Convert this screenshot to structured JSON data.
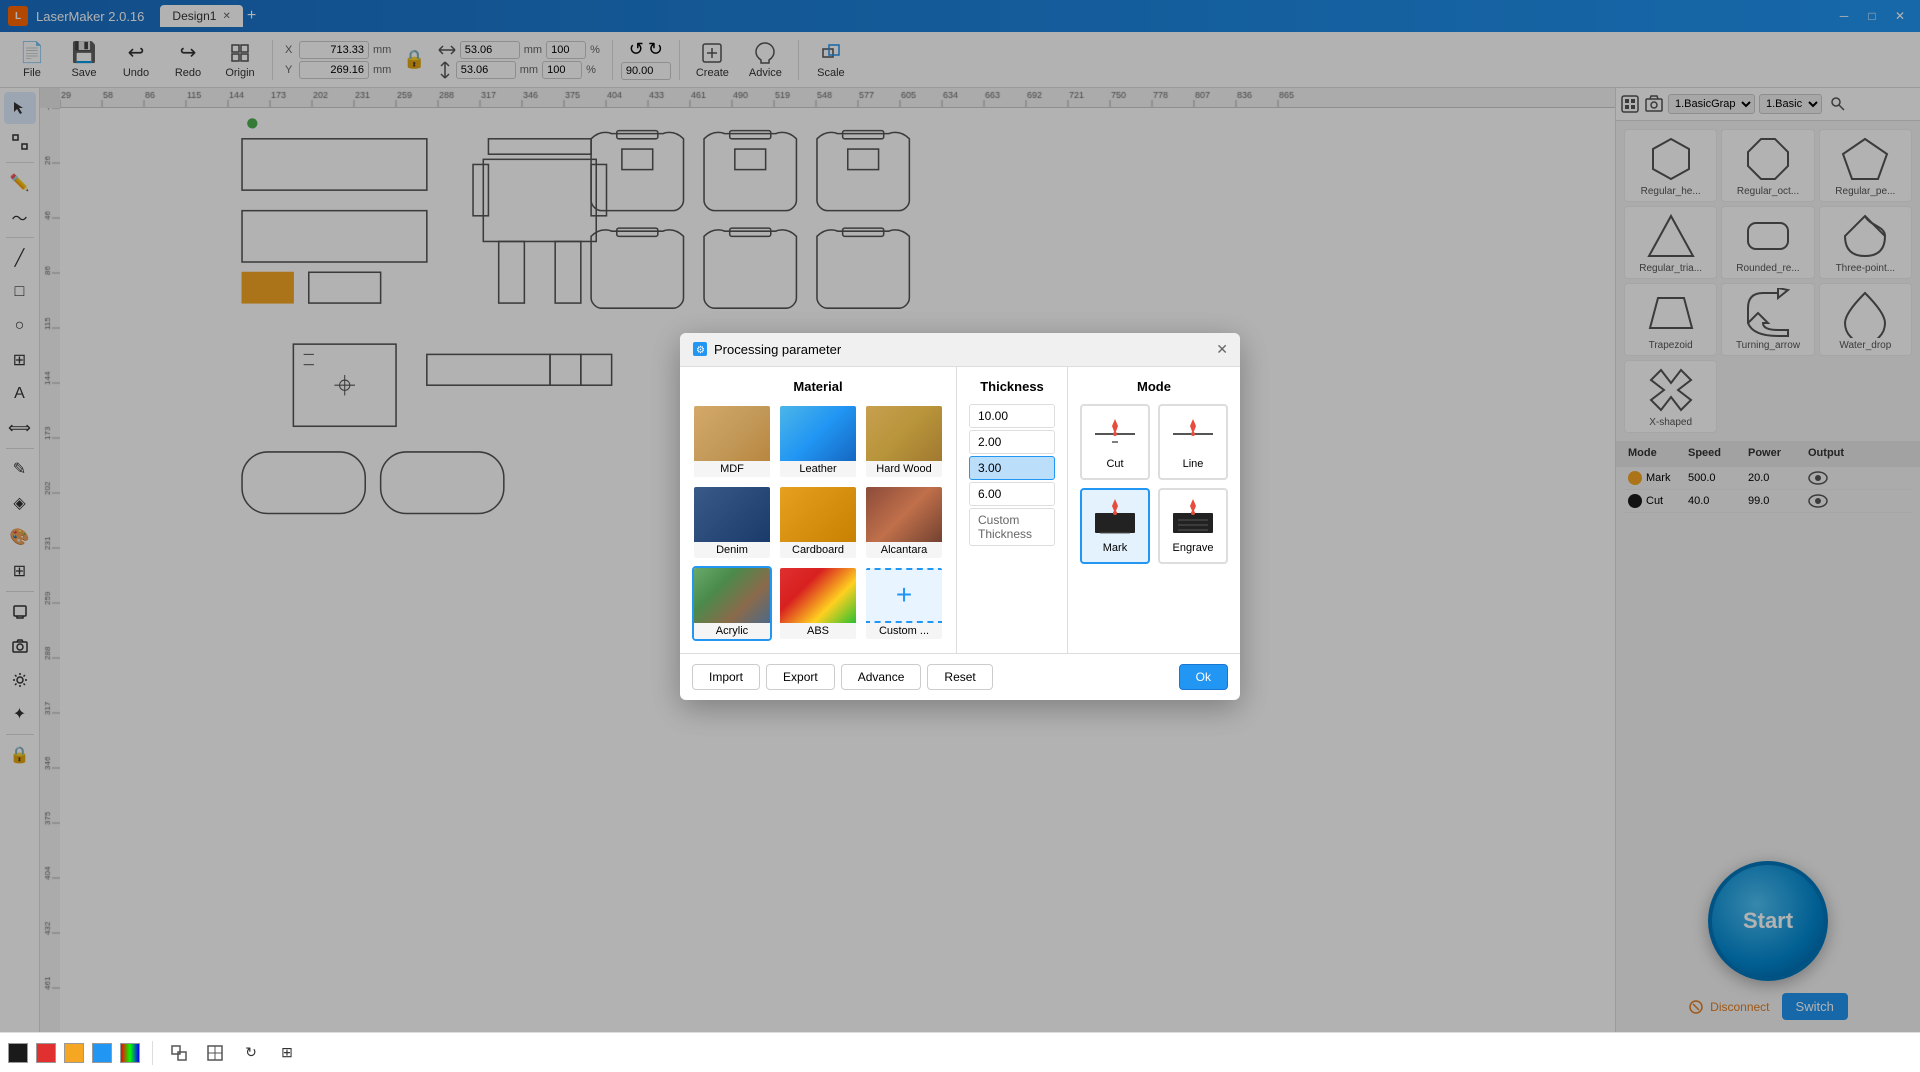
{
  "app": {
    "name": "LaserMaker 2.0.16",
    "tab": "Design1"
  },
  "toolbar": {
    "file_label": "File",
    "save_label": "Save",
    "undo_label": "Undo",
    "redo_label": "Redo",
    "origin_label": "Origin",
    "scale_label": "Scale",
    "create_label": "Create",
    "advice_label": "Advice",
    "x_label": "X",
    "y_label": "Y",
    "x_value": "713.33",
    "y_value": "269.16",
    "unit": "mm",
    "w_value": "53.06",
    "h_value": "53.06",
    "w_pct": "100",
    "h_pct": "100",
    "angle_value": "90.00"
  },
  "shapes_panel": {
    "dropdown1": "1.BasicGrap",
    "dropdown2": "1.Basic",
    "items": [
      {
        "id": "regular_hex",
        "label": "Regular_he..."
      },
      {
        "id": "regular_oct",
        "label": "Regular_oct..."
      },
      {
        "id": "regular_pe",
        "label": "Regular_pe..."
      },
      {
        "id": "regular_tri",
        "label": "Regular_tria..."
      },
      {
        "id": "rounded_re",
        "label": "Rounded_re..."
      },
      {
        "id": "three_point",
        "label": "Three-point..."
      },
      {
        "id": "trapezoid",
        "label": "Trapezoid"
      },
      {
        "id": "turning_arrow",
        "label": "Turning_arrow"
      },
      {
        "id": "water_drop",
        "label": "Water_drop"
      },
      {
        "id": "x_shaped",
        "label": "X-shaped"
      }
    ]
  },
  "mode_table": {
    "headers": [
      "Mode",
      "Speed",
      "Power",
      "Output"
    ],
    "rows": [
      {
        "color": "#f5a623",
        "color_name": "yellow",
        "label": "Mark",
        "speed": "500.0",
        "power": "20.0"
      },
      {
        "color": "#1a1a1a",
        "color_name": "black",
        "label": "Cut",
        "speed": "40.0",
        "power": "99.0"
      }
    ]
  },
  "dialog": {
    "title": "Processing parameter",
    "sections": {
      "material": {
        "title": "Material",
        "items": [
          {
            "id": "mdf",
            "label": "MDF"
          },
          {
            "id": "leather",
            "label": "Leather"
          },
          {
            "id": "hard_wood",
            "label": "Hard Wood"
          },
          {
            "id": "denim",
            "label": "Denim"
          },
          {
            "id": "cardboard",
            "label": "Cardboard"
          },
          {
            "id": "alcantara",
            "label": "Alcantara"
          },
          {
            "id": "acrylic",
            "label": "Acrylic",
            "selected": true
          },
          {
            "id": "abs",
            "label": "ABS"
          },
          {
            "id": "custom",
            "label": "Custom ..."
          }
        ]
      },
      "thickness": {
        "title": "Thickness",
        "items": [
          {
            "value": "10.00"
          },
          {
            "value": "2.00"
          },
          {
            "value": "3.00",
            "selected": true
          },
          {
            "value": "6.00"
          }
        ],
        "custom_label": "Custom Thickness"
      },
      "mode": {
        "title": "Mode",
        "options": [
          {
            "id": "cut",
            "label": "Cut",
            "selected": false
          },
          {
            "id": "line",
            "label": "Line"
          },
          {
            "id": "mark",
            "label": "Mark",
            "selected": true
          },
          {
            "id": "engrave",
            "label": "Engrave"
          }
        ]
      }
    },
    "buttons": {
      "import": "Import",
      "export": "Export",
      "advance": "Advance",
      "reset": "Reset",
      "ok": "Ok"
    }
  },
  "bottom_bar": {
    "colors": [
      "#1a1a1a",
      "#e03030",
      "#f5a623",
      "#2196F3",
      "gradient"
    ]
  },
  "right_bottom": {
    "start_label": "Start",
    "disconnect_label": "Disconnect",
    "switch_label": "Switch"
  }
}
